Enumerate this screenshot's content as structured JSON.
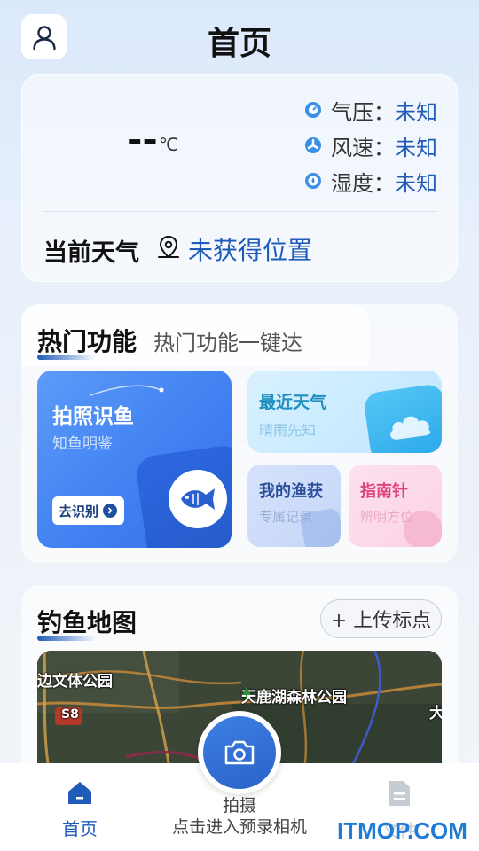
{
  "header": {
    "title": "首页"
  },
  "weather": {
    "temperature": "--",
    "unit": "℃",
    "metrics": [
      {
        "label": "气压：",
        "value": "未知",
        "icon": "pressure-icon"
      },
      {
        "label": "风速：",
        "value": "未知",
        "icon": "wind-icon"
      },
      {
        "label": "湿度：",
        "value": "未知",
        "icon": "humidity-icon"
      }
    ],
    "current_label": "当前天气",
    "location_text": "未获得位置"
  },
  "hot": {
    "title": "热门功能",
    "subtitle": "热门功能一键达",
    "features": [
      {
        "title": "拍照识鱼",
        "sub": "知鱼明鉴",
        "button": "去识别"
      },
      {
        "title": "最近天气",
        "sub": "晴雨先知"
      },
      {
        "title": "我的渔获",
        "sub": "专属记录"
      },
      {
        "title": "指南针",
        "sub": "辨明方位"
      }
    ]
  },
  "map": {
    "title": "钓鱼地图",
    "upload_label": "+ 上传标点",
    "labels": [
      "边文体公园",
      "天鹿湖森林公园",
      "S8",
      "大"
    ]
  },
  "nav": {
    "items": [
      {
        "label": "首页",
        "icon": "home-icon"
      },
      {
        "label": "文件",
        "icon": "file-icon"
      }
    ],
    "camera_label": "拍摄",
    "camera_sub": "点击进入预录相机"
  },
  "watermark": "ITMOP.COM",
  "colors": {
    "accent": "#1f5bb8",
    "primary_blue": "#3f7ff1"
  }
}
